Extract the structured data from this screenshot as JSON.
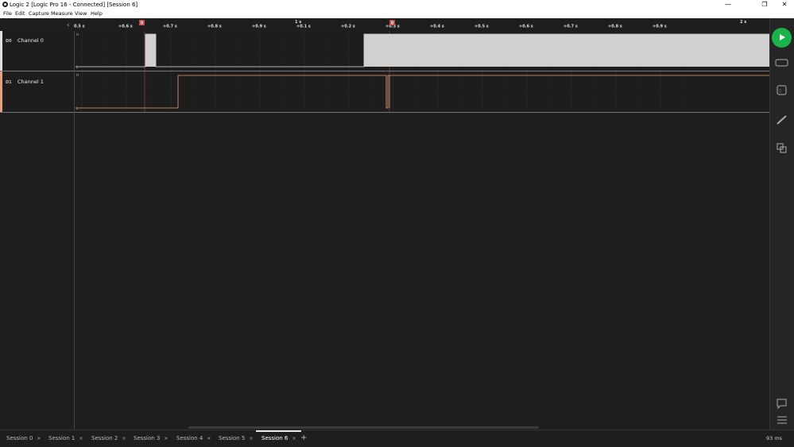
{
  "window": {
    "title": "Logic 2 [Logic Pro 16 - Connected] [Session 6]",
    "minimize": "—",
    "maximize": "❐",
    "close": "✕"
  },
  "menu": [
    "File",
    "Edit",
    "Capture",
    "Measure",
    "View",
    "Help"
  ],
  "ruler": {
    "ticks": [
      "0.5 s",
      "+0.6 s",
      "+0.7 s",
      "+0.8 s",
      "+0.9 s",
      "+0.1 s",
      "+0.2 s",
      "+0.3 s",
      "+0.4 s",
      "+0.5 s",
      "+0.6 s",
      "+0.7 s",
      "+0.8 s",
      "+0.9 s"
    ],
    "major": [
      "1 s",
      "2 s"
    ],
    "markers": [
      "0",
      "0"
    ],
    "collapse_icon": "‹"
  },
  "channels": [
    {
      "number": "D0",
      "name": "Channel 0",
      "high": "H",
      "low": "L",
      "color": "#e0e0e0"
    },
    {
      "number": "D1",
      "name": "Channel 1",
      "high": "H",
      "low": "L",
      "color": "#e8a07a"
    }
  ],
  "tabs": [
    "Session 0",
    "Session 1",
    "Session 2",
    "Session 3",
    "Session 4",
    "Session 5",
    "Session 6"
  ],
  "active_tab": "Session 6",
  "tab_close": "×",
  "add_tab": "+",
  "zoom": "93 ms",
  "sidebar_icons": [
    "play-icon",
    "analyzers-icon",
    "extensions-icon",
    "measure-icon",
    "timing-markers-icon",
    "notes-icon",
    "menu-icon"
  ]
}
